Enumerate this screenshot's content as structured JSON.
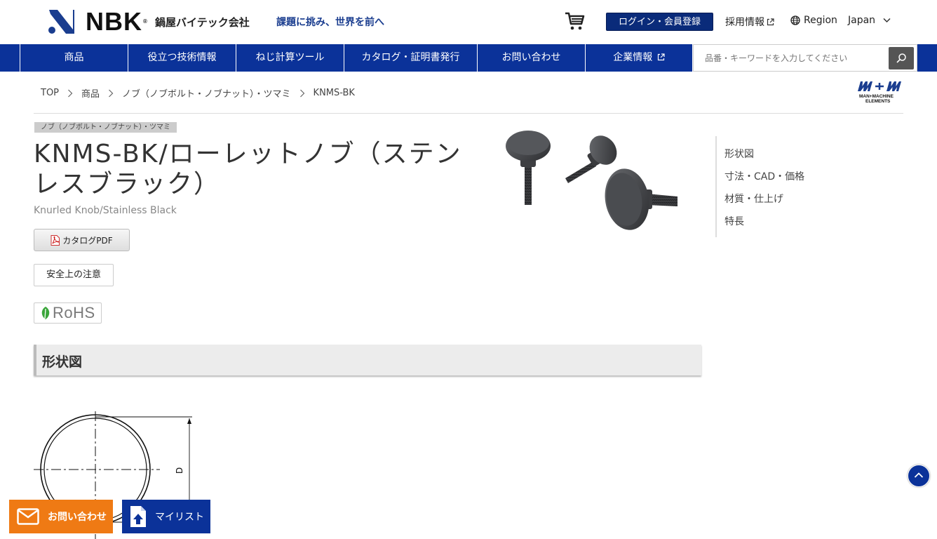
{
  "header": {
    "logo_text": "NBK",
    "company_name": "鍋屋バイテック会社",
    "tagline": "課題に挑み、世界を前へ",
    "login_label": "ログイン・会員登録",
    "recruit_label": "採用情報",
    "region_label": "Region",
    "country_label": "Japan"
  },
  "nav": {
    "items": [
      "商品",
      "役立つ技術情報",
      "ねじ計算ツール",
      "カタログ・証明書発行",
      "お問い合わせ",
      "企業情報"
    ],
    "search_placeholder": "品番・キーワードを入力してください"
  },
  "breadcrumb": [
    "TOP",
    "商品",
    "ノブ（ノブボルト・ノブナット）・ツマミ",
    "KNMS-BK"
  ],
  "brand_badge": {
    "line1": "MAN+MACHINE",
    "line2": "ELEMENTS"
  },
  "product": {
    "category_tag": "ノブ（ノブボルト・ノブナット）・ツマミ",
    "title": "KNMS-BK/ローレットノブ（ステンレスブラック）",
    "subtitle": "Knurled Knob/Stainless Black",
    "pdf_label": "カタログPDF",
    "safety_label": "安全上の注意",
    "rohs_label": "RoHS"
  },
  "side_nav": [
    "形状図",
    "寸法・CAD・価格",
    "材質・仕上げ",
    "特長"
  ],
  "section": {
    "title": "形状図",
    "dimension_label": "D"
  },
  "floating": {
    "contact_label": "お問い合わせ",
    "mylist_label": "マイリスト"
  },
  "colors": {
    "primary": "#0b3299",
    "accent": "#ef7a14",
    "login": "#0a2b7a"
  }
}
